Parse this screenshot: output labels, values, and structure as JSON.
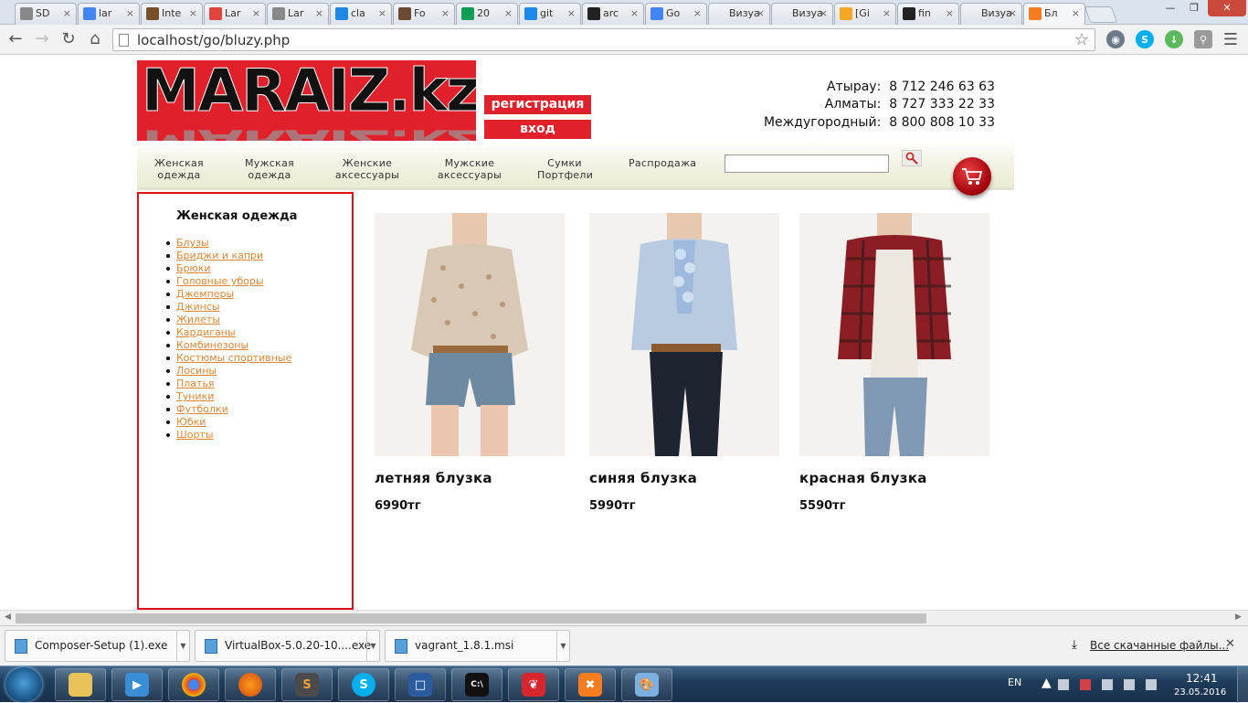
{
  "browser": {
    "tabs": [
      {
        "label": "SD",
        "icon": "page-icon",
        "color": "#888888"
      },
      {
        "label": "lar",
        "icon": "google-icon",
        "color": "#4285f4"
      },
      {
        "label": "Inte",
        "icon": "habr-icon",
        "color": "#7a4f2b"
      },
      {
        "label": "Lar",
        "icon": "laravel-icon",
        "color": "#e0443a"
      },
      {
        "label": "Lar",
        "icon": "page-icon",
        "color": "#888888"
      },
      {
        "label": "cla",
        "icon": "search-q-icon",
        "color": "#1e88e5"
      },
      {
        "label": "Fo",
        "icon": "forum-icon",
        "color": "#6b4a33"
      },
      {
        "label": "20",
        "icon": "sheets-icon",
        "color": "#0f9d58"
      },
      {
        "label": "git",
        "icon": "search-q-icon",
        "color": "#1e88e5"
      },
      {
        "label": "arc",
        "icon": "github-icon",
        "color": "#222222"
      },
      {
        "label": "Go",
        "icon": "google-icon",
        "color": "#4285f4"
      },
      {
        "label": "Визуа",
        "icon": "none",
        "color": "#ffffff"
      },
      {
        "label": "Визуа",
        "icon": "none",
        "color": "#ffffff"
      },
      {
        "label": "[Gi",
        "icon": "at-icon",
        "color": "#f5a623"
      },
      {
        "label": "fin",
        "icon": "github-icon",
        "color": "#222222"
      },
      {
        "label": "Визуа",
        "icon": "none",
        "color": "#ffffff"
      },
      {
        "label": "Бл",
        "icon": "xampp-icon",
        "color": "#f57c1f"
      }
    ],
    "url": "localhost/go/bluzy.php"
  },
  "site": {
    "logo_text": "MARAIZ.kz",
    "register_label": "регистрация",
    "login_label": "вход",
    "phones": [
      {
        "city": "Атырау:",
        "number": "8 712 246 63 63"
      },
      {
        "city": "Алматы:",
        "number": "8 727 333 22 33"
      },
      {
        "city": "Междугородный:",
        "number": "8 800 808 10 33"
      }
    ],
    "nav": [
      {
        "line1": "Женская",
        "line2": "одежда"
      },
      {
        "line1": "Мужская",
        "line2": "одежда"
      },
      {
        "line1": "Женские",
        "line2": "аксессуары"
      },
      {
        "line1": "Мужские",
        "line2": "аксессуары"
      },
      {
        "line1": "Сумки",
        "line2": "Портфели"
      },
      {
        "line1": "Распродажа",
        "line2": ""
      }
    ],
    "search_value": "",
    "sidebar": {
      "heading": "Женская одежда",
      "links": [
        "Блузы",
        "Бриджи и капри",
        "Брюки",
        "Головные уборы",
        "Джемперы",
        "Джинсы",
        "Жилеты",
        "Кардиганы",
        "Комбинезоны",
        "Костюмы спортивные",
        "Лосины",
        "Платья",
        "Туники",
        "Футболки",
        "Юбки",
        "Шорты"
      ]
    },
    "products": [
      {
        "name": "летняя блузка",
        "price": "6990тг"
      },
      {
        "name": "синяя блузка",
        "price": "5990тг"
      },
      {
        "name": "красная блузка",
        "price": "5590тг"
      }
    ]
  },
  "downloads": {
    "items": [
      "Composer-Setup (1).exe",
      "VirtualBox-5.0.20-10....exe",
      "vagrant_1.8.1.msi"
    ],
    "show_all": "Все скачанные файлы..."
  },
  "taskbar": {
    "lang": "EN",
    "time": "12:41",
    "date": "23.05.2016"
  }
}
